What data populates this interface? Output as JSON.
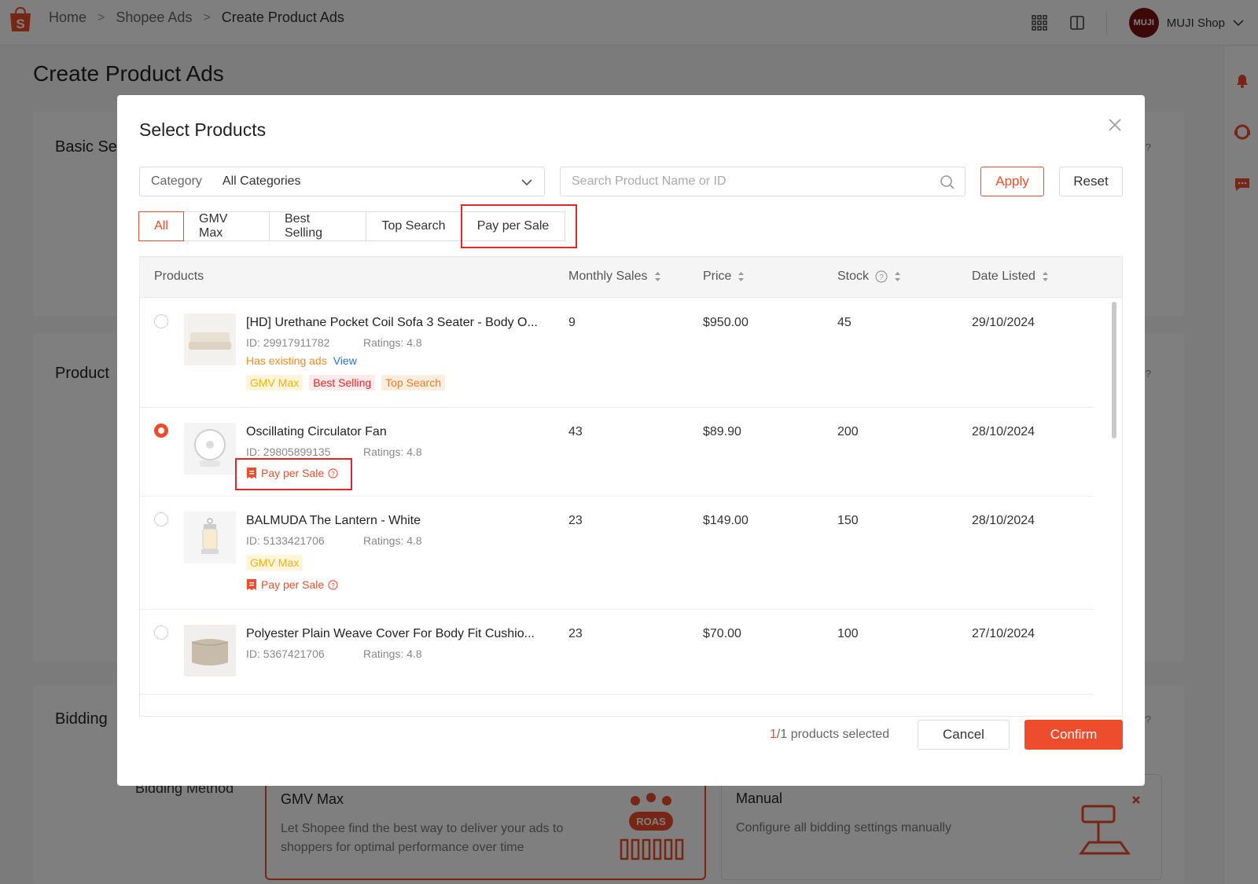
{
  "breadcrumb": {
    "home": "Home",
    "ads": "Shopee Ads",
    "current": "Create Product Ads"
  },
  "header": {
    "avatar_text": "MUJI",
    "shop_name": "MUJI Shop"
  },
  "page": {
    "title": "Create Product Ads",
    "section_basic": "Basic Se",
    "section_basic_hint": "gs?",
    "section_product": "Product",
    "section_product_hint": "cts?",
    "section_bidding": "Bidding",
    "section_bidding_hint": "gy?",
    "bidding_method_label": "Bidding Method",
    "bidding_options": [
      {
        "title": "GMV Max",
        "desc": "Let Shopee find the best way to deliver your ads to shoppers for optimal performance over time",
        "badge": "ROAS"
      },
      {
        "title": "Manual",
        "desc": "Configure all bidding settings manually"
      }
    ]
  },
  "modal": {
    "title": "Select Products",
    "category_label": "Category",
    "category_value": "All Categories",
    "search_placeholder": "Search Product Name or ID",
    "apply_label": "Apply",
    "reset_label": "Reset",
    "tabs": [
      "All",
      "GMV Max",
      "Best Selling",
      "Top Search",
      "Pay per Sale"
    ],
    "active_tab": "All",
    "columns": [
      "Products",
      "Monthly Sales",
      "Price",
      "Stock",
      "Date Listed"
    ],
    "rows": [
      {
        "name": "[HD] Urethane Pocket Coil Sofa 3 Seater - Body O...",
        "id": "ID: 29917911782",
        "ratings": "Ratings: 4.8",
        "existing": "Has existing ads",
        "view": "View",
        "tags": [
          "GMV Max",
          "Best Selling",
          "Top Search"
        ],
        "monthly_sales": "9",
        "price": "$950.00",
        "stock": "45",
        "date": "29/10/2024",
        "selected": false
      },
      {
        "name": "Oscillating Circulator Fan",
        "id": "ID: 29805899135",
        "ratings": "Ratings: 4.8",
        "pps": "Pay per Sale",
        "monthly_sales": "43",
        "price": "$89.90",
        "stock": "200",
        "date": "28/10/2024",
        "selected": true
      },
      {
        "name": "BALMUDA The Lantern - White",
        "id": "ID: 5133421706",
        "ratings": "Ratings: 4.8",
        "tags": [
          "GMV Max"
        ],
        "pps": "Pay per Sale",
        "monthly_sales": "23",
        "price": "$149.00",
        "stock": "150",
        "date": "28/10/2024",
        "selected": false
      },
      {
        "name": "Polyester Plain Weave Cover For Body Fit Cushio...",
        "id": "ID: 5367421706",
        "ratings": "Ratings: 4.8",
        "monthly_sales": "23",
        "price": "$70.00",
        "stock": "100",
        "date": "27/10/2024",
        "selected": false
      }
    ],
    "selected_count": "1",
    "selected_suffix": "/1 products selected",
    "cancel_label": "Cancel",
    "confirm_label": "Confirm"
  },
  "colors": {
    "brand": "#ee4d2d",
    "highlight": "#e0282a",
    "gmv_tag": "#f5b400",
    "top_tag": "#f07c26",
    "link": "#2673dd"
  }
}
